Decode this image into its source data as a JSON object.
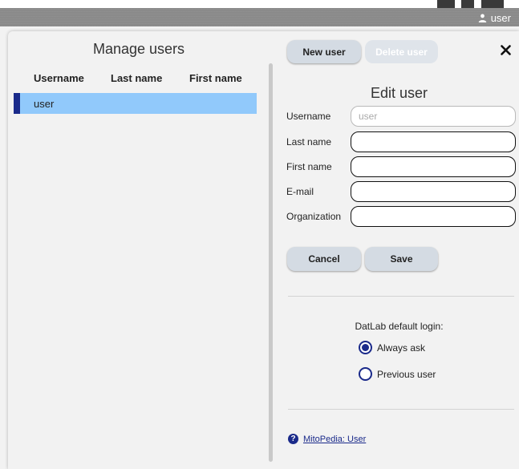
{
  "header": {
    "user_label": "user"
  },
  "users_panel": {
    "title": "Manage users",
    "columns": [
      "Username",
      "Last name",
      "First name"
    ],
    "rows": [
      {
        "username": "user",
        "last_name": "",
        "first_name": ""
      }
    ]
  },
  "toolbar": {
    "new_user_label": "New user",
    "delete_user_label": "Delete user"
  },
  "edit_form": {
    "title": "Edit user",
    "fields": [
      {
        "label": "Username",
        "value": "",
        "placeholder": "user",
        "disabled": true
      },
      {
        "label": "Last name",
        "value": "",
        "placeholder": ""
      },
      {
        "label": "First name",
        "value": "",
        "placeholder": ""
      },
      {
        "label": "E-mail",
        "value": "",
        "placeholder": ""
      },
      {
        "label": "Organization",
        "value": "",
        "placeholder": ""
      }
    ],
    "cancel_label": "Cancel",
    "save_label": "Save"
  },
  "login_default": {
    "title": "DatLab default login:",
    "options": [
      {
        "label": "Always ask",
        "selected": true
      },
      {
        "label": "Previous user",
        "selected": false
      }
    ]
  },
  "help": {
    "link_label": "MitoPedia: User"
  },
  "colors": {
    "accent": "#1a2a8a",
    "selected_row": "#91c9fb",
    "button_bg": "#d4dbe3"
  }
}
